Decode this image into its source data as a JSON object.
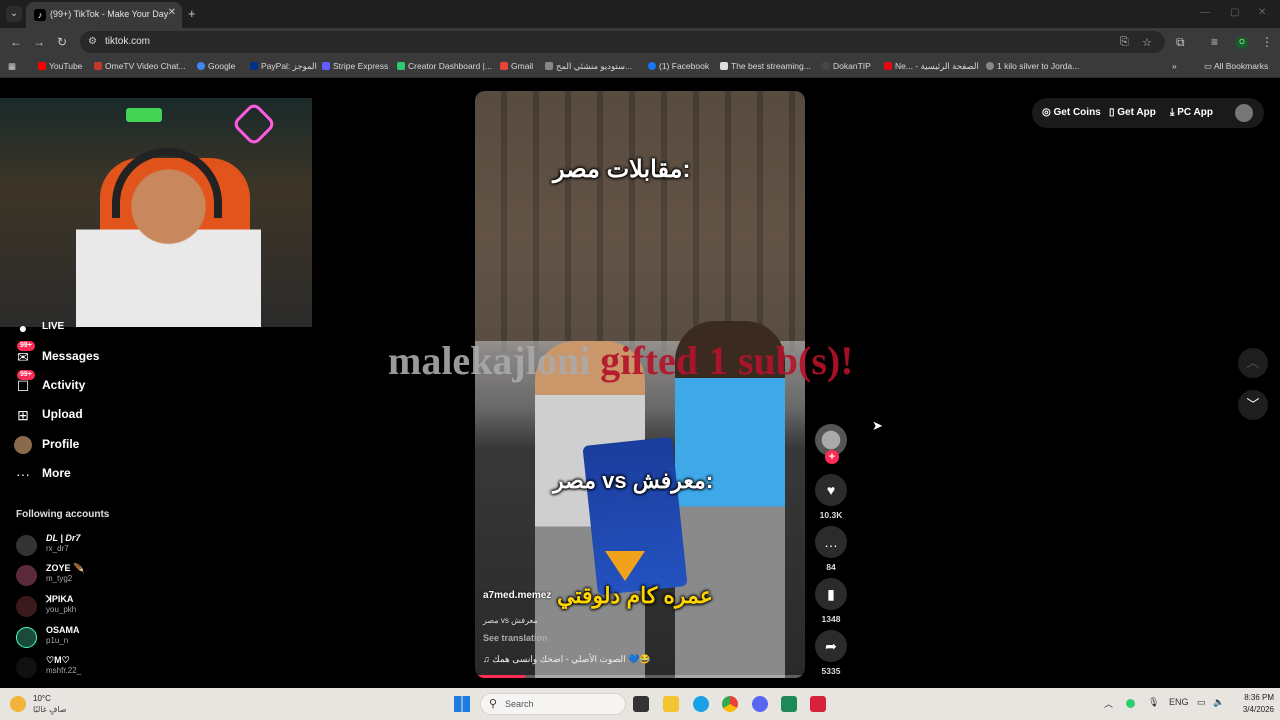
{
  "browser": {
    "tab_title": "(99+) TikTok - Make Your Day",
    "url": "tiktok.com",
    "bookmarks": [
      {
        "label": "YouTube",
        "color": "#ff0000"
      },
      {
        "label": "OmeTV Video Chat...",
        "color": "#c0392b"
      },
      {
        "label": "Google",
        "color": "#4285f4"
      },
      {
        "label": "PayPal: الموجز",
        "color": "#003087"
      },
      {
        "label": "Stripe Express",
        "color": "#635bff"
      },
      {
        "label": "Creator Dashboard |...",
        "color": "#2ecc71"
      },
      {
        "label": "Gmail",
        "color": "#ea4335"
      },
      {
        "label": "ستوديو منشئي المح...",
        "color": "#888888"
      },
      {
        "label": "(1) Facebook",
        "color": "#1877f2"
      },
      {
        "label": "The best streaming...",
        "color": "#dddddd"
      },
      {
        "label": "DokanTIP",
        "color": "#444444"
      },
      {
        "label": "Ne... - الصفحة الرئيسية",
        "color": "#e50914"
      },
      {
        "label": "1 kilo silver to Jorda...",
        "color": "#888888"
      }
    ],
    "all_bookmarks": "All Bookmarks",
    "profile_initial": "O"
  },
  "sidebar": {
    "items": [
      {
        "label": "LIVE",
        "icon": "live-icon",
        "badge": ""
      },
      {
        "label": "Messages",
        "icon": "messages-icon",
        "badge": "99+"
      },
      {
        "label": "Activity",
        "icon": "activity-icon",
        "badge": "99+"
      },
      {
        "label": "Upload",
        "icon": "upload-icon",
        "badge": ""
      },
      {
        "label": "Profile",
        "icon": "profile-icon",
        "badge": ""
      },
      {
        "label": "More",
        "icon": "more-icon",
        "badge": ""
      }
    ],
    "following_title": "Following accounts",
    "accounts": [
      {
        "name": "DL | Dr7",
        "handle": "rx_dr7"
      },
      {
        "name": "ZOYE 🪶",
        "handle": "m_tyg2"
      },
      {
        "name": "ꓘPIKA",
        "handle": "you_pkh"
      },
      {
        "name": "OSAMA",
        "handle": "p1u_n"
      },
      {
        "name": "♡M♡",
        "handle": "mshfr.22_"
      }
    ]
  },
  "video": {
    "caption_top": "مقابلات مصر:",
    "caption_mid": "مصر vs معرفش:",
    "caption_bottom": "عمره كام دلوقتي",
    "username": "a7med.memez",
    "description": "مصر vs معرفش",
    "see_translation": "See translation",
    "music": "الصوت الأصلي - اضحك وانسى همك 💙😂",
    "progress": 0.15
  },
  "overlay": {
    "name": "malekajloni",
    "rest": "gifted 1 sub(s)!"
  },
  "actions": {
    "likes": "10.3K",
    "comments": "84",
    "saves": "1348",
    "shares": "5335"
  },
  "topbar": {
    "get_coins": "Get Coins",
    "get_app": "Get App",
    "pc_app": "PC App"
  },
  "taskbar": {
    "temp": "10°C",
    "condition": "صافٍ غالبًا",
    "search_placeholder": "Search",
    "lang": "ENG",
    "time": "8:36 PM",
    "date": "3/4/2026"
  }
}
